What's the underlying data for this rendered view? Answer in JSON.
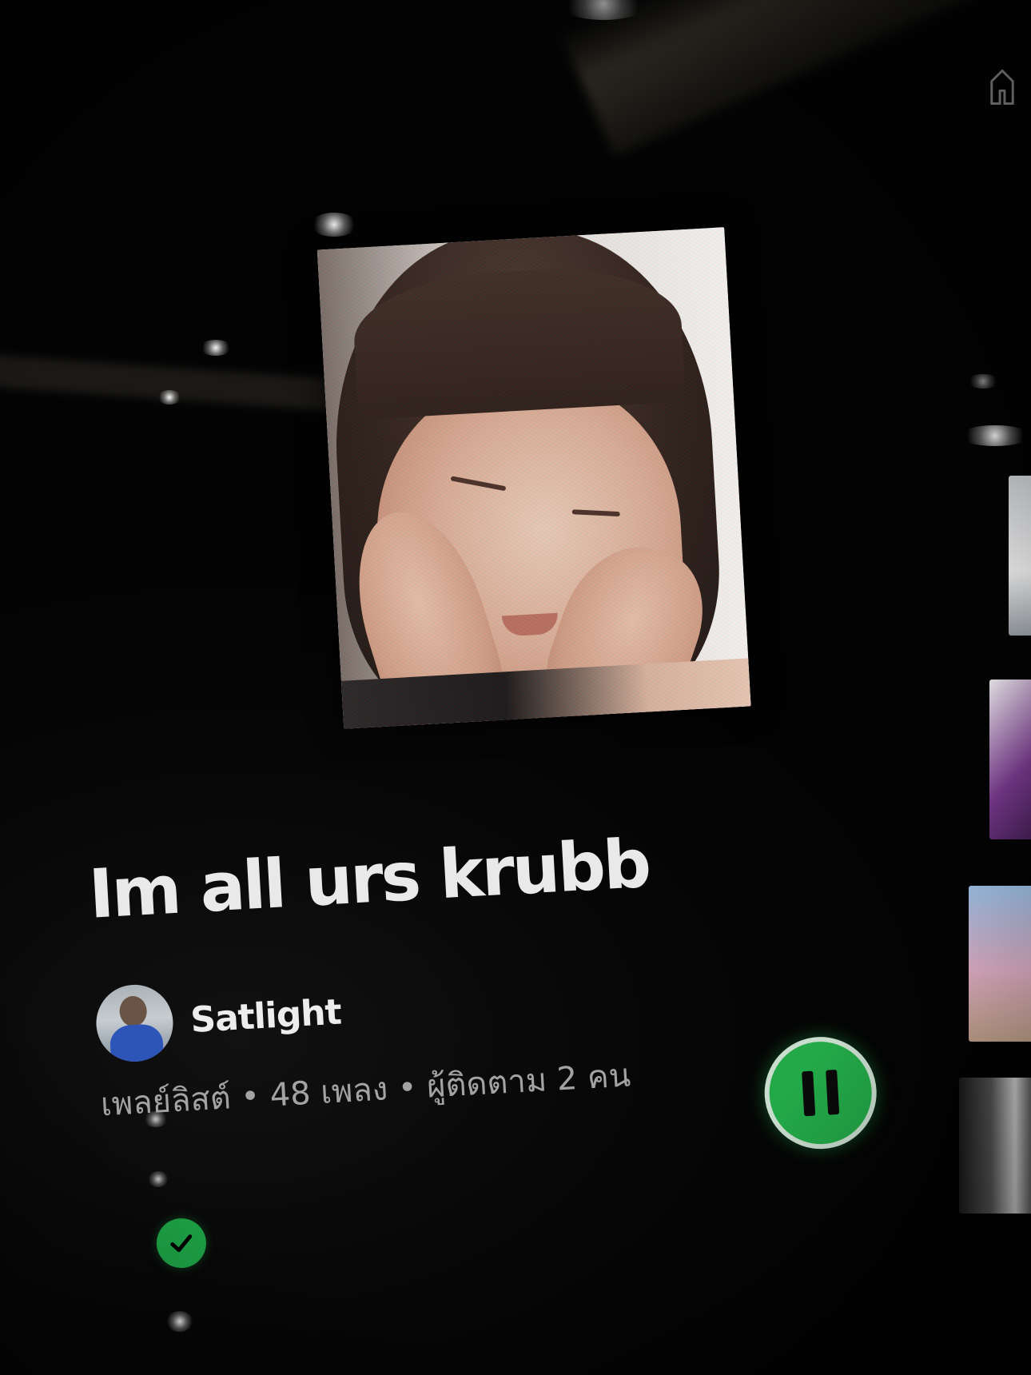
{
  "playlist": {
    "title": "Im all urs krubb",
    "owner": "Satlight",
    "meta": "เพลย์ลิสต์ • 48 เพลง • ผู้ติดตาม 2 คน"
  },
  "controls": {
    "saved_icon": "check-icon",
    "play_state_icon": "pause-icon"
  },
  "colors": {
    "accent": "#1ea447",
    "background": "#050505",
    "title_text": "#e9e9e9",
    "meta_text": "#a3a3a3"
  }
}
